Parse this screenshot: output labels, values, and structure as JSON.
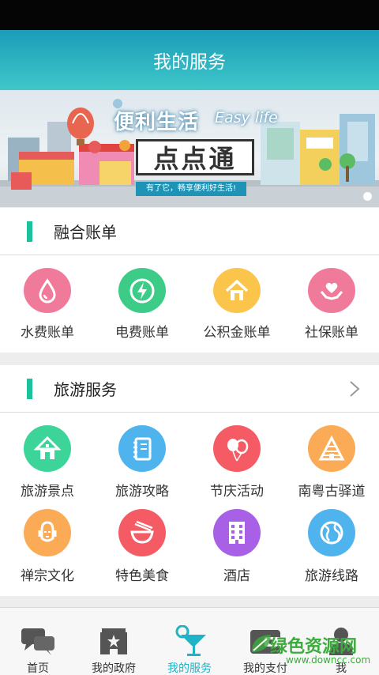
{
  "header": {
    "title": "我的服务"
  },
  "banner": {
    "title": "便利生活",
    "title_en": "Easy life",
    "brand": "点点通",
    "subtitle": "有了它，畅享便利好生活!"
  },
  "bills": {
    "title": "融合账单",
    "items": [
      {
        "label": "水费账单",
        "icon": "water-drop-icon",
        "color": "#f07a9a"
      },
      {
        "label": "电费账单",
        "icon": "lightning-icon",
        "color": "#3dcc87"
      },
      {
        "label": "公积金账单",
        "icon": "house-icon",
        "color": "#fbc54c"
      },
      {
        "label": "社保账单",
        "icon": "heart-hands-icon",
        "color": "#f07a9a"
      }
    ]
  },
  "travel": {
    "title": "旅游服务",
    "items": [
      {
        "label": "旅游景点",
        "icon": "pavilion-icon",
        "color": "#3dd49a"
      },
      {
        "label": "旅游攻略",
        "icon": "notebook-icon",
        "color": "#4fb4ee"
      },
      {
        "label": "节庆活动",
        "icon": "balloons-icon",
        "color": "#f55b64"
      },
      {
        "label": "南粤古驿道",
        "icon": "pyramid-icon",
        "color": "#fbaa55"
      },
      {
        "label": "禅宗文化",
        "icon": "buddha-icon",
        "color": "#fbaa55"
      },
      {
        "label": "特色美食",
        "icon": "bowl-icon",
        "color": "#f55b64"
      },
      {
        "label": "酒店",
        "icon": "building-icon",
        "color": "#a860e6"
      },
      {
        "label": "旅游线路",
        "icon": "globe-icon",
        "color": "#4fb4ee"
      }
    ]
  },
  "tabs": [
    {
      "label": "首页",
      "icon": "chat-icon",
      "active": false
    },
    {
      "label": "我的政府",
      "icon": "government-icon",
      "active": false
    },
    {
      "label": "我的服务",
      "icon": "cocktail-icon",
      "active": true
    },
    {
      "label": "我的支付",
      "icon": "wallet-icon",
      "active": false
    },
    {
      "label": "我",
      "icon": "person-icon",
      "active": false
    }
  ],
  "watermark": {
    "text": "绿色资源网",
    "url": "www.downcc.com"
  }
}
